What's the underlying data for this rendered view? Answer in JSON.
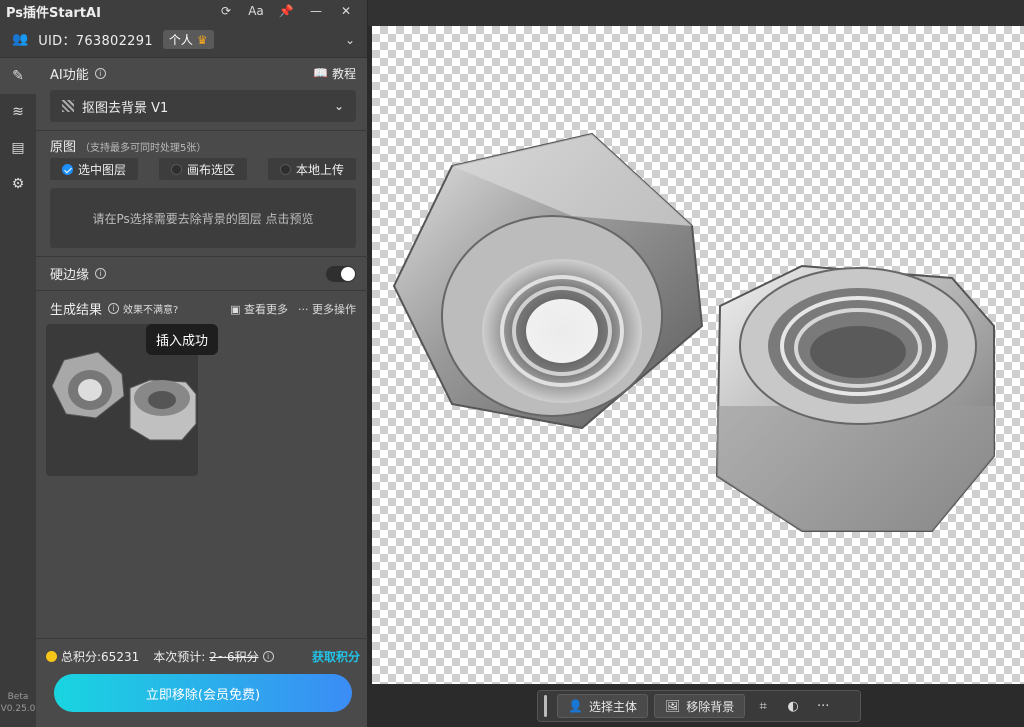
{
  "panel": {
    "title": "Ps插件StartAI",
    "titlebar_icons": [
      "refresh-icon",
      "font-size-icon",
      "pin-icon",
      "minimize-icon",
      "close-icon"
    ],
    "font_size_label": "Aa",
    "uid": "UID：763802291",
    "account_tag": "个人",
    "ai_feature_label": "AI功能",
    "tutorial_label": "教程",
    "selected_feature": "抠图去背景 V1",
    "source_label": "原图",
    "source_hint": "（支持最多可同时处理5张）",
    "source_options": [
      {
        "label": "选中图层",
        "checked": true
      },
      {
        "label": "画布选区",
        "checked": false
      },
      {
        "label": "本地上传",
        "checked": false
      }
    ],
    "dropzone_text": "请在Ps选择需要去除背景的图层 点击预览",
    "hard_edge_label": "硬边缘",
    "hard_edge_enabled": false,
    "result_label": "生成结果",
    "unsatisfied_label": "效果不满意?",
    "view_more_label": "查看更多",
    "more_actions_label": "··· 更多操作",
    "tooltip": "插入成功",
    "total_points_label": "总积分:65231",
    "estimate_label": "本次预计:",
    "estimate_value": "2~6积分",
    "get_points_label": "获取积分",
    "cta_label": "立即移除(会员免费)",
    "version_beta": "Beta",
    "version": "V0.25.0"
  },
  "context_bar": {
    "select_subject": "选择主体",
    "remove_bg": "移除背景",
    "more": "···"
  },
  "colors": {
    "accent": "#1e90ff",
    "cta_start": "#19d5e0",
    "cta_end": "#3b8cf5",
    "get_points": "#22c3e6",
    "coin": "#f5c518"
  }
}
